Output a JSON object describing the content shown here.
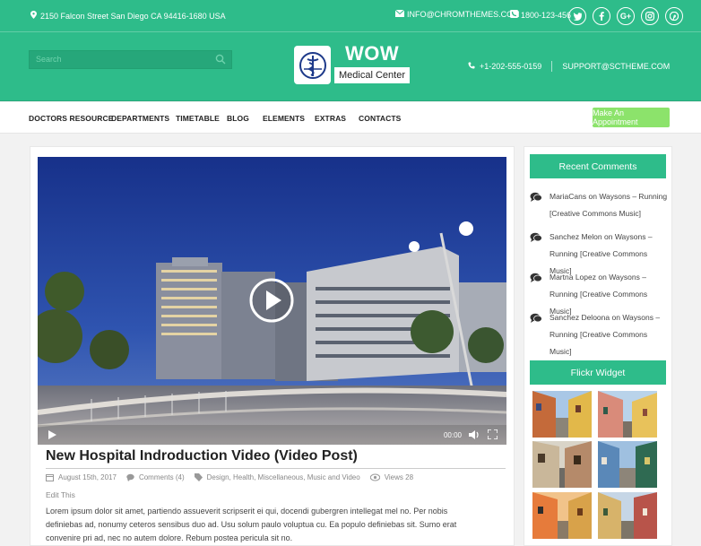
{
  "topbar": {
    "address": "2150 Falcon Street San Diego CA 94416-1680 USA",
    "email": "INFO@CHROMTHEMES.COM",
    "phone": "1800-123-456",
    "social_icons": [
      "twitter-icon",
      "facebook-icon",
      "google-plus-icon",
      "instagram-icon",
      "pinterest-icon"
    ]
  },
  "header": {
    "search_placeholder": "Search",
    "logo_title": "WOW",
    "logo_subtitle": "Medical Center",
    "contact_phone": "+1-202-555-0159",
    "contact_email": "SUPPORT@SCTHEME.COM"
  },
  "nav": {
    "items": [
      "DOCTORS RESOURCE",
      "DEPARTMENTS",
      "TIMETABLE",
      "BLOG",
      "ELEMENTS",
      "EXTRAS",
      "CONTACTS"
    ],
    "cta": "Make An Appointment"
  },
  "video": {
    "time": "00:00"
  },
  "post": {
    "title": "New Hospital Indroduction Video (Video Post)",
    "date": "August 15th, 2017",
    "comments": "Comments (4)",
    "categories": "Design, Health, Miscellaneous, Music and Video",
    "views": "Views 28",
    "edit": "Edit This",
    "body": "Lorem ipsum dolor sit amet, partiendo assueverit scripserit ei qui, docendi gubergren intellegat mel no. Per nobis definiebas ad, nonumy ceteros sensibus duo ad. Usu solum paulo voluptua cu. Ea populo definiebas sit. Sumo erat convenire pri ad, nec no autem dolore. Rebum postea pericula sit no."
  },
  "sidebar": {
    "recent_title": "Recent Comments",
    "comments": [
      {
        "author": "MariaCans",
        "on": "on",
        "post": "Waysons – Running [Creative Commons Music]"
      },
      {
        "author": "Sanchez Melon",
        "on": "on",
        "post": "Waysons – Running [Creative Commons Music]"
      },
      {
        "author": "Martna Lopez",
        "on": "on",
        "post": "Waysons – Running [Creative Commons Music]"
      },
      {
        "author": "Sanchez Deloona",
        "on": "on",
        "post": "Waysons – Running [Creative Commons Music]"
      }
    ],
    "flickr_title": "Flickr Widget"
  },
  "colors": {
    "brand": "#2ebc8a",
    "cta": "#8ce36b"
  }
}
